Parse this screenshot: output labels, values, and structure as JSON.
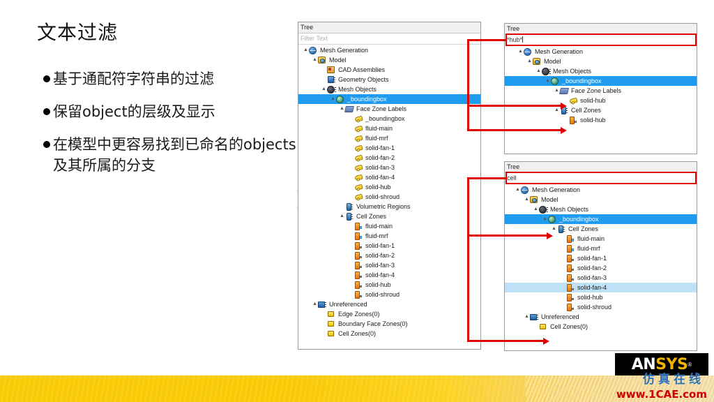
{
  "slide": {
    "title": "文本过滤",
    "bullets": [
      "基于通配符字符串的过滤",
      "保留object的层级及显示",
      "在模型中更容易找到已命名的objects 及其所属的分支"
    ],
    "watermark": "1CAE"
  },
  "footer": {
    "logo_an": "AN",
    "logo_sys": "SYS",
    "logo_tm": "®",
    "watermark_cn": "仿真在线",
    "watermark_url": "www.1CAE.com",
    "band_color": "#f7c900"
  },
  "colors": {
    "selection_blue": "#1f9bf0",
    "selection_soft": "#bfe1f7",
    "annotation_red": "#e00000",
    "tag_yellow": "#f2c000",
    "cellzone_orange": "#e8720c"
  },
  "panels": {
    "full_tree": {
      "title": "Tree",
      "filter_value": "",
      "filter_placeholder": "Filter Text",
      "rows": [
        {
          "indent": 0,
          "twist": "▲",
          "icon": "globe-icon",
          "label": "Mesh Generation",
          "state": "normal"
        },
        {
          "indent": 1,
          "twist": "▲",
          "icon": "model-icon",
          "label": "Model",
          "state": "normal"
        },
        {
          "indent": 2,
          "twist": "",
          "icon": "cad-assemblies-icon",
          "label": "CAD Assemblies",
          "state": "normal"
        },
        {
          "indent": 2,
          "twist": "",
          "icon": "geometry-objects-icon",
          "label": "Geometry Objects",
          "state": "normal"
        },
        {
          "indent": 2,
          "twist": "▲",
          "icon": "mesh-objects-icon",
          "label": "Mesh Objects",
          "state": "normal"
        },
        {
          "indent": 3,
          "twist": "▲",
          "icon": "mesh-object-icon",
          "label": "_boundingbox",
          "state": "selected"
        },
        {
          "indent": 4,
          "twist": "▲",
          "icon": "face-zone-labels-icon",
          "label": "Face Zone Labels",
          "state": "normal"
        },
        {
          "indent": 5,
          "twist": "",
          "icon": "face-zone-tag-icon",
          "label": "_boundingbox",
          "state": "normal"
        },
        {
          "indent": 5,
          "twist": "",
          "icon": "face-zone-tag-icon",
          "label": "fluid-main",
          "state": "normal"
        },
        {
          "indent": 5,
          "twist": "",
          "icon": "face-zone-tag-icon",
          "label": "fluid-mrf",
          "state": "normal"
        },
        {
          "indent": 5,
          "twist": "",
          "icon": "face-zone-tag-icon",
          "label": "solid-fan-1",
          "state": "normal"
        },
        {
          "indent": 5,
          "twist": "",
          "icon": "face-zone-tag-icon",
          "label": "solid-fan-2",
          "state": "normal"
        },
        {
          "indent": 5,
          "twist": "",
          "icon": "face-zone-tag-icon",
          "label": "solid-fan-3",
          "state": "normal"
        },
        {
          "indent": 5,
          "twist": "",
          "icon": "face-zone-tag-icon",
          "label": "solid-fan-4",
          "state": "normal"
        },
        {
          "indent": 5,
          "twist": "",
          "icon": "face-zone-tag-icon",
          "label": "solid-hub",
          "state": "normal"
        },
        {
          "indent": 5,
          "twist": "",
          "icon": "face-zone-tag-icon",
          "label": "solid-shroud",
          "state": "normal"
        },
        {
          "indent": 4,
          "twist": "",
          "icon": "volumetric-regions-icon",
          "label": "Volumetric Regions",
          "state": "normal"
        },
        {
          "indent": 4,
          "twist": "▲",
          "icon": "cell-zones-icon",
          "label": "Cell Zones",
          "state": "normal"
        },
        {
          "indent": 5,
          "twist": "",
          "icon": "cell-zone-fluid-icon",
          "label": "fluid-main",
          "state": "normal"
        },
        {
          "indent": 5,
          "twist": "",
          "icon": "cell-zone-fluid-icon",
          "label": "fluid-mrf",
          "state": "normal"
        },
        {
          "indent": 5,
          "twist": "",
          "icon": "cell-zone-solid-icon",
          "label": "solid-fan-1",
          "state": "normal"
        },
        {
          "indent": 5,
          "twist": "",
          "icon": "cell-zone-solid-icon",
          "label": "solid-fan-2",
          "state": "normal"
        },
        {
          "indent": 5,
          "twist": "",
          "icon": "cell-zone-solid-icon",
          "label": "solid-fan-3",
          "state": "normal"
        },
        {
          "indent": 5,
          "twist": "",
          "icon": "cell-zone-solid-icon",
          "label": "solid-fan-4",
          "state": "normal"
        },
        {
          "indent": 5,
          "twist": "",
          "icon": "cell-zone-solid-icon",
          "label": "solid-hub",
          "state": "normal"
        },
        {
          "indent": 5,
          "twist": "",
          "icon": "cell-zone-solid-icon",
          "label": "solid-shroud",
          "state": "normal"
        },
        {
          "indent": 1,
          "twist": "▲",
          "icon": "unreferenced-icon",
          "label": "Unreferenced",
          "state": "normal"
        },
        {
          "indent": 2,
          "twist": "",
          "icon": "zone-icon",
          "label": "Edge Zones(0)",
          "state": "normal"
        },
        {
          "indent": 2,
          "twist": "",
          "icon": "zone-icon",
          "label": "Boundary Face Zones(0)",
          "state": "normal"
        },
        {
          "indent": 2,
          "twist": "",
          "icon": "zone-icon",
          "label": "Cell Zones(0)",
          "state": "normal"
        }
      ]
    },
    "filtered_hub": {
      "title": "Tree",
      "filter_value": "*hub*",
      "filter_placeholder": "Filter Text",
      "rows": [
        {
          "indent": 0,
          "twist": "▲",
          "icon": "globe-icon",
          "label": "Mesh Generation",
          "state": "normal"
        },
        {
          "indent": 1,
          "twist": "▲",
          "icon": "model-icon",
          "label": "Model",
          "state": "normal"
        },
        {
          "indent": 2,
          "twist": "▲",
          "icon": "mesh-objects-icon",
          "label": "Mesh Objects",
          "state": "normal"
        },
        {
          "indent": 3,
          "twist": "▲",
          "icon": "mesh-object-icon",
          "label": "_boundingbox",
          "state": "selected"
        },
        {
          "indent": 4,
          "twist": "▲",
          "icon": "face-zone-labels-icon",
          "label": "Face Zone Labels",
          "state": "normal"
        },
        {
          "indent": 5,
          "twist": "",
          "icon": "face-zone-tag-icon",
          "label": "solid-hub",
          "state": "normal"
        },
        {
          "indent": 4,
          "twist": "▲",
          "icon": "cell-zones-icon",
          "label": "Cell Zones",
          "state": "normal"
        },
        {
          "indent": 5,
          "twist": "",
          "icon": "cell-zone-solid-icon",
          "label": "solid-hub",
          "state": "normal"
        }
      ]
    },
    "filtered_cell": {
      "title": "Tree",
      "filter_value": "cell",
      "filter_placeholder": "Filter Text",
      "rows": [
        {
          "indent": 0,
          "twist": "▲",
          "icon": "globe-icon",
          "label": "Mesh Generation",
          "state": "normal"
        },
        {
          "indent": 1,
          "twist": "▲",
          "icon": "model-icon",
          "label": "Model",
          "state": "normal"
        },
        {
          "indent": 2,
          "twist": "▲",
          "icon": "mesh-objects-icon",
          "label": "Mesh Objects",
          "state": "normal"
        },
        {
          "indent": 3,
          "twist": "▲",
          "icon": "mesh-object-icon",
          "label": "_boundingbox",
          "state": "selected"
        },
        {
          "indent": 4,
          "twist": "▲",
          "icon": "cell-zones-icon",
          "label": "Cell Zones",
          "state": "normal"
        },
        {
          "indent": 5,
          "twist": "",
          "icon": "cell-zone-fluid-icon",
          "label": "fluid-main",
          "state": "normal"
        },
        {
          "indent": 5,
          "twist": "",
          "icon": "cell-zone-fluid-icon",
          "label": "fluid-mrf",
          "state": "normal"
        },
        {
          "indent": 5,
          "twist": "",
          "icon": "cell-zone-solid-icon",
          "label": "solid-fan-1",
          "state": "normal"
        },
        {
          "indent": 5,
          "twist": "",
          "icon": "cell-zone-solid-icon",
          "label": "solid-fan-2",
          "state": "normal"
        },
        {
          "indent": 5,
          "twist": "",
          "icon": "cell-zone-solid-icon",
          "label": "solid-fan-3",
          "state": "normal"
        },
        {
          "indent": 5,
          "twist": "",
          "icon": "cell-zone-solid-icon",
          "label": "solid-fan-4",
          "state": "soft-selected"
        },
        {
          "indent": 5,
          "twist": "",
          "icon": "cell-zone-solid-icon",
          "label": "solid-hub",
          "state": "normal"
        },
        {
          "indent": 5,
          "twist": "",
          "icon": "cell-zone-solid-icon",
          "label": "solid-shroud",
          "state": "normal"
        },
        {
          "indent": 1,
          "twist": "▲",
          "icon": "unreferenced-icon",
          "label": "Unreferenced",
          "state": "normal"
        },
        {
          "indent": 2,
          "twist": "",
          "icon": "zone-icon",
          "label": "Cell Zones(0)",
          "state": "normal"
        }
      ]
    }
  }
}
